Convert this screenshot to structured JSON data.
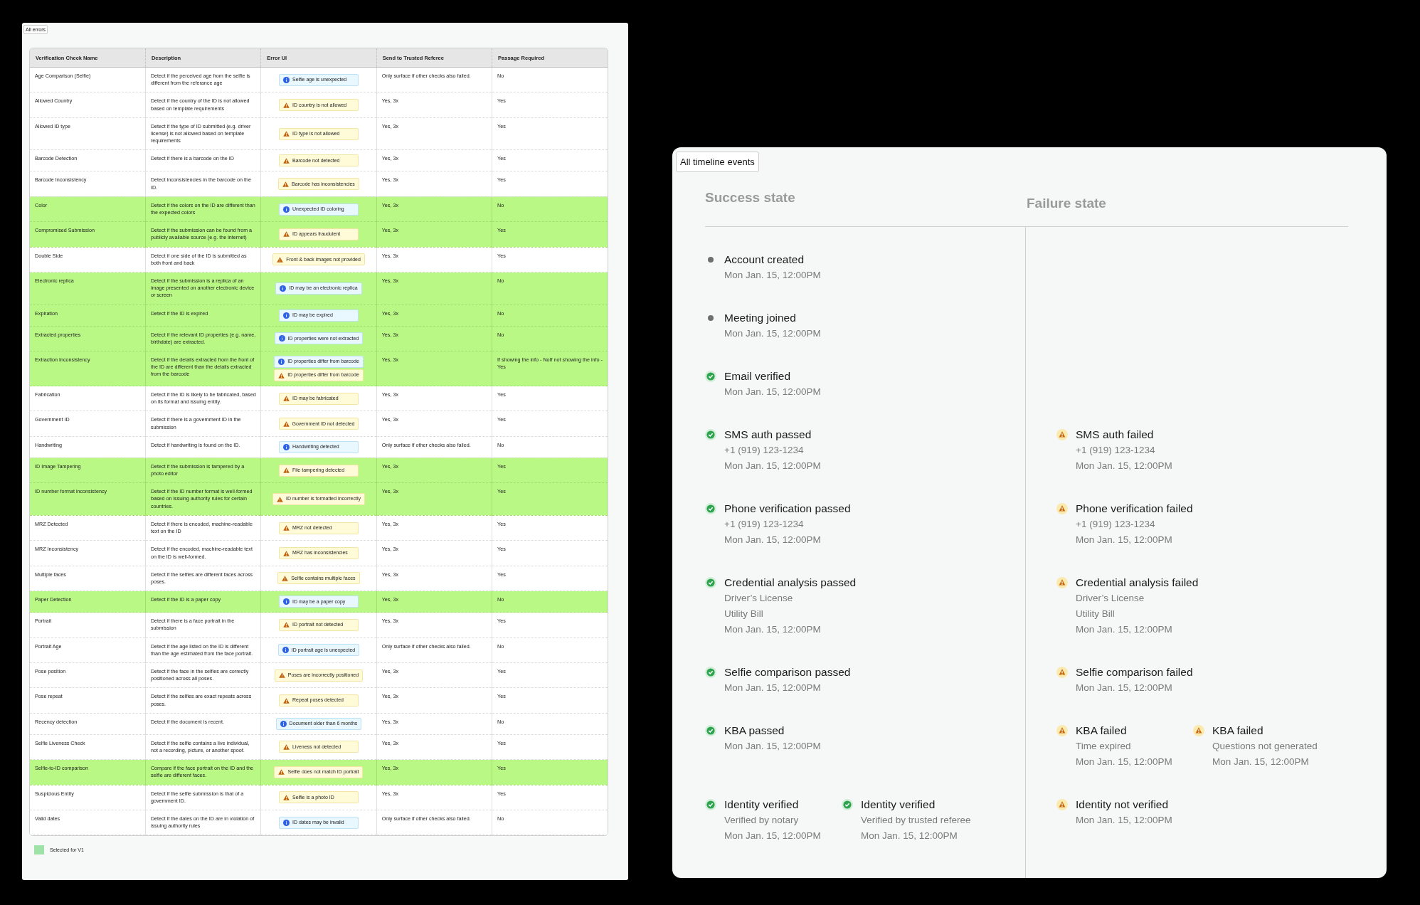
{
  "errors_panel": {
    "label": "All errors",
    "table": {
      "columns": [
        "Verification Check Name",
        "Description",
        "Error UI",
        "Send to Trusted Referee",
        "Passage Required"
      ],
      "rows": [
        {
          "name": "Age Comparison (Selfie)",
          "description": "Detect if the perceived age from the selfie is different from the referance age",
          "errors": [
            {
              "kind": "info",
              "text": "Selfie age is unexpected"
            }
          ],
          "referee": "Only surface if other checks also failed.",
          "passage": "No",
          "selected": false
        },
        {
          "name": "Allowed Country",
          "description": "Detect if the country of the ID is not allowed based on template requirements",
          "errors": [
            {
              "kind": "warning",
              "text": "ID country is not allowed"
            }
          ],
          "referee": "Yes, 3x",
          "passage": "Yes",
          "selected": false
        },
        {
          "name": "Allowed ID type",
          "description": "Detect if the type of ID submitted (e.g. driver license) is not allowed based on template requirements",
          "errors": [
            {
              "kind": "warning",
              "text": "ID type is not allowed"
            }
          ],
          "referee": "Yes, 3x",
          "passage": "Yes",
          "selected": false
        },
        {
          "name": "Barcode Detection",
          "description": "Detect if there is a barcode on the ID",
          "errors": [
            {
              "kind": "warning",
              "text": "Barcode not detected"
            }
          ],
          "referee": "Yes, 3x",
          "passage": "Yes",
          "selected": false
        },
        {
          "name": "Barcode Inconsistency",
          "description": "Detect inconsistencies in the barcode on the ID.",
          "errors": [
            {
              "kind": "warning",
              "text": "Barcode has inconsistencies"
            }
          ],
          "referee": "Yes, 3x",
          "passage": "Yes",
          "selected": false
        },
        {
          "name": "Color",
          "description": "Detect if the colors on the ID are different than the expected colors",
          "errors": [
            {
              "kind": "info",
              "text": "Unexpected ID coloring"
            }
          ],
          "referee": "Yes, 3x",
          "passage": "No",
          "selected": true
        },
        {
          "name": "Compromised Submission",
          "description": "Detect if the submission can be found from a publicly available source (e.g. the internet)",
          "errors": [
            {
              "kind": "warning",
              "text": "ID appears fraudulent"
            }
          ],
          "referee": "Yes, 3x",
          "passage": "Yes",
          "selected": true
        },
        {
          "name": "Double Side",
          "description": "Detect if one side of the ID is submitted as both front and back",
          "errors": [
            {
              "kind": "warning",
              "text": "Front & back images not provided"
            }
          ],
          "referee": "Yes, 3x",
          "passage": "Yes",
          "selected": false
        },
        {
          "name": "Electronic replica",
          "description": "Detect if the submission is a replica of an image presented on another electronic device or screen",
          "errors": [
            {
              "kind": "info",
              "text": "ID may be an electronic replica"
            }
          ],
          "referee": "Yes,  3x",
          "passage": "No",
          "selected": true
        },
        {
          "name": "Expiration",
          "description": "Detect if the ID is expired",
          "errors": [
            {
              "kind": "info",
              "text": "ID may be expired"
            }
          ],
          "referee": "Yes,  3x",
          "passage": "No",
          "selected": true
        },
        {
          "name": "Extracted properties",
          "description": "Detect if the relevant ID properties (e.g. name, birthdate) are extracted.",
          "errors": [
            {
              "kind": "info",
              "text": "ID properties were not extracted"
            }
          ],
          "referee": "Yes, 3x",
          "passage": "No",
          "selected": true
        },
        {
          "name": "Extraction Inconsistency",
          "description": "Detect if the details extracted from the front of the ID are different than the details extracted from the barcode",
          "errors": [
            {
              "kind": "info",
              "text": "ID properties differ from barcode"
            },
            {
              "kind": "warning",
              "text": "ID properties differ from barcode"
            }
          ],
          "referee": "Yes, 3x",
          "passage": "If showing the info - NoIf not showing the info - Yes",
          "selected": true
        },
        {
          "name": "Fabrication",
          "description": "Detect if the ID is likely to be fabricated, based on its format and issuing entity.",
          "errors": [
            {
              "kind": "warning",
              "text": "ID may be fabricated"
            }
          ],
          "referee": "Yes, 3x",
          "passage": "Yes",
          "selected": false
        },
        {
          "name": "Government ID",
          "description": "Detect if there is a government ID in the submission",
          "errors": [
            {
              "kind": "warning",
              "text": "Government ID not detected"
            }
          ],
          "referee": "Yes, 3x",
          "passage": "Yes",
          "selected": false
        },
        {
          "name": "Handwriting",
          "description": "Detect if handwriting is found on the ID.",
          "errors": [
            {
              "kind": "info",
              "text": "Handwriting detected"
            }
          ],
          "referee": "Only surface if other checks also failed.",
          "passage": "No",
          "selected": false
        },
        {
          "name": "ID Image Tampering",
          "description": "Detect if the submission is tampered by a photo editor",
          "errors": [
            {
              "kind": "warning",
              "text": "File tampering detected"
            }
          ],
          "referee": "Yes, 3x",
          "passage": "Yes",
          "selected": true
        },
        {
          "name": "ID number format inconsistency",
          "description": "Detect if the ID number format is well-formed based on issuing authority rules for certain countries.",
          "errors": [
            {
              "kind": "warning",
              "text": "ID number is formatted incorrectly"
            }
          ],
          "referee": "Yes, 3x",
          "passage": "Yes",
          "selected": true
        },
        {
          "name": "MRZ Detected",
          "description": "Detect if there is encoded, machine-readable text on the ID",
          "errors": [
            {
              "kind": "warning",
              "text": "MRZ not detected"
            }
          ],
          "referee": "Yes, 3x",
          "passage": "Yes",
          "selected": false
        },
        {
          "name": "MRZ Inconsistency",
          "description": "Detect if the encoded, machine-readable text on the ID is well-formed.",
          "errors": [
            {
              "kind": "warning",
              "text": "MRZ has inconsistencies"
            }
          ],
          "referee": "Yes, 3x",
          "passage": "Yes",
          "selected": false
        },
        {
          "name": "Multiple faces",
          "description": "Detect if the selfies are different faces across poses.",
          "errors": [
            {
              "kind": "warning",
              "text": "Selfie contains multiple faces"
            }
          ],
          "referee": "Yes, 3x",
          "passage": "Yes",
          "selected": false
        },
        {
          "name": "Paper Detection",
          "description": "Detect if the ID is a paper copy",
          "errors": [
            {
              "kind": "info",
              "text": "ID may be a paper copy"
            }
          ],
          "referee": "Yes, 3x",
          "passage": "No",
          "selected": true
        },
        {
          "name": "Portrait",
          "description": "Detect if there is a face portrait in the submission",
          "errors": [
            {
              "kind": "warning",
              "text": "ID portrait not detected"
            }
          ],
          "referee": "Yes, 3x",
          "passage": "Yes",
          "selected": false
        },
        {
          "name": "Portrait Age",
          "description": "Detect if the age listed on the ID is different than the age estimated from the face portrait.",
          "errors": [
            {
              "kind": "info",
              "text": "ID portrait age is unexpected"
            }
          ],
          "referee": "Only surface if other checks also failed.",
          "passage": "No",
          "selected": false
        },
        {
          "name": "Pose position",
          "description": "Detect if the face in the selfies are correctly positioned across all poses.",
          "errors": [
            {
              "kind": "warning",
              "text": "Poses are incorrectly positioned"
            }
          ],
          "referee": "Yes, 3x",
          "passage": "Yes",
          "selected": false
        },
        {
          "name": "Pose repeat",
          "description": "Detect if the selfies are exact repeats across poses.",
          "errors": [
            {
              "kind": "warning",
              "text": "Repeat poses detected"
            }
          ],
          "referee": "Yes, 3x",
          "passage": "Yes",
          "selected": false
        },
        {
          "name": "Recency detection",
          "description": "Detect if the document is recent.",
          "errors": [
            {
              "kind": "info",
              "text": "Document older than 6 months"
            }
          ],
          "referee": "Yes, 3x",
          "passage": "No",
          "selected": false
        },
        {
          "name": "Selfie Liveness Check",
          "description": "Detect if the selfie contains a live individual, not a recording, picture, or another spoof.",
          "errors": [
            {
              "kind": "warning",
              "text": "Liveness not detected"
            }
          ],
          "referee": "Yes, 3x",
          "passage": "Yes",
          "selected": false
        },
        {
          "name": "Selfie-to-ID comparison",
          "description": "Compare if the face portrait on the ID and the selfie are different faces.",
          "errors": [
            {
              "kind": "warning",
              "text": "Selfie does not match ID portrait"
            }
          ],
          "referee": "Yes, 3x",
          "passage": "Yes",
          "selected": true
        },
        {
          "name": "Suspicious Entity",
          "description": "Detect if the selfie submission is that of a government ID.",
          "errors": [
            {
              "kind": "warning",
              "text": "Selfie is a photo ID"
            }
          ],
          "referee": "Yes, 3x",
          "passage": "Yes",
          "selected": false
        },
        {
          "name": "Valid dates",
          "description": "Detect if the dates on the ID are in violation of issuing authority rules",
          "errors": [
            {
              "kind": "info",
              "text": "ID dates may be invalid"
            }
          ],
          "referee": "Only surface if other checks also failed.",
          "passage": "No",
          "selected": false
        }
      ]
    },
    "legend": {
      "label": "Selected for V1"
    }
  },
  "timeline_panel": {
    "label": "All timeline events",
    "success_heading": "Success state",
    "failure_heading": "Failure state",
    "rows": [
      {
        "success": [
          {
            "kind": "neutral",
            "title": "Account created",
            "details": [
              "Mon Jan. 15, 12:00PM"
            ]
          }
        ],
        "failure": []
      },
      {
        "success": [
          {
            "kind": "neutral",
            "title": "Meeting joined",
            "details": [
              "Mon Jan. 15, 12:00PM"
            ]
          }
        ],
        "failure": []
      },
      {
        "success": [
          {
            "kind": "success",
            "title": "Email verified",
            "details": [
              "Mon Jan. 15, 12:00PM"
            ]
          }
        ],
        "failure": []
      },
      {
        "success": [
          {
            "kind": "success",
            "title": "SMS auth passed",
            "details": [
              "+1 (919) 123-1234",
              "Mon Jan. 15, 12:00PM"
            ]
          }
        ],
        "failure": [
          {
            "kind": "warning",
            "title": "SMS auth failed",
            "details": [
              "+1 (919) 123-1234",
              "Mon Jan. 15, 12:00PM"
            ]
          }
        ]
      },
      {
        "success": [
          {
            "kind": "success",
            "title": "Phone verification passed",
            "details": [
              "+1 (919) 123-1234",
              "Mon Jan. 15, 12:00PM"
            ]
          }
        ],
        "failure": [
          {
            "kind": "warning",
            "title": "Phone verification failed",
            "details": [
              "+1 (919) 123-1234",
              "Mon Jan. 15, 12:00PM"
            ]
          }
        ]
      },
      {
        "success": [
          {
            "kind": "success",
            "title": "Credential analysis passed",
            "details": [
              "Driver’s License",
              "Utility Bill",
              "Mon Jan. 15, 12:00PM"
            ]
          }
        ],
        "failure": [
          {
            "kind": "warning",
            "title": "Credential analysis failed",
            "details": [
              "Driver’s License",
              "Utility Bill",
              "Mon Jan. 15, 12:00PM"
            ]
          }
        ]
      },
      {
        "success": [
          {
            "kind": "success",
            "title": "Selfie comparison passed",
            "details": [
              "Mon Jan. 15, 12:00PM"
            ]
          }
        ],
        "failure": [
          {
            "kind": "warning",
            "title": "Selfie comparison failed",
            "details": [
              "Mon Jan. 15, 12:00PM"
            ]
          }
        ]
      },
      {
        "success": [
          {
            "kind": "success",
            "title": "KBA passed",
            "details": [
              "Mon Jan. 15, 12:00PM"
            ]
          }
        ],
        "failure": [
          {
            "kind": "warning",
            "title": "KBA failed",
            "details": [
              "Time expired",
              "Mon Jan. 15, 12:00PM"
            ]
          },
          {
            "kind": "warning",
            "title": "KBA failed",
            "details": [
              "Questions not generated",
              "Mon Jan. 15, 12:00PM"
            ]
          }
        ]
      },
      {
        "success": [
          {
            "kind": "success",
            "title": "Identity verified",
            "details": [
              "Verified by notary",
              "Mon Jan. 15, 12:00PM"
            ]
          },
          {
            "kind": "success",
            "title": "Identity verified",
            "details": [
              "Verified by trusted referee",
              "Mon Jan. 15, 12:00PM"
            ]
          }
        ],
        "failure": [
          {
            "kind": "warning",
            "title": "Identity not verified",
            "details": [
              "Mon Jan. 15, 12:00PM"
            ]
          }
        ]
      }
    ]
  }
}
